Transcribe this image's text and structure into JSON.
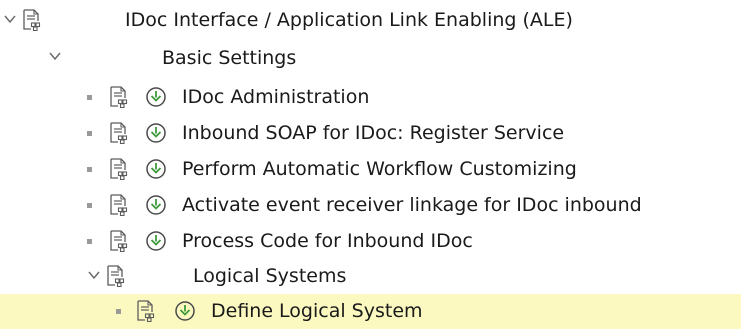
{
  "tree": {
    "root": {
      "label": "IDoc Interface / Application Link Enabling (ALE)",
      "expanded": true
    },
    "basic_settings": {
      "label": "Basic Settings",
      "expanded": true,
      "items": [
        {
          "label": "IDoc Administration"
        },
        {
          "label": "Inbound SOAP for IDoc: Register Service"
        },
        {
          "label": "Perform Automatic Workflow Customizing"
        },
        {
          "label": "Activate event receiver linkage for IDoc inbound"
        },
        {
          "label": "Process Code for Inbound IDoc"
        }
      ]
    },
    "logical_systems": {
      "label": "Logical Systems",
      "expanded": true,
      "items": [
        {
          "label": "Define Logical System",
          "selected": true
        }
      ]
    }
  },
  "colors": {
    "selected_row_bg": "#fbf9c0",
    "execute_icon_green": "#3e9a3b",
    "text": "#1a1a1a",
    "icon_gray": "#5c5c5c"
  },
  "icons": {
    "expanded": "chevron-down-icon",
    "document": "document-icon",
    "execute": "clock-execute-icon",
    "leaf": "bullet-icon"
  }
}
